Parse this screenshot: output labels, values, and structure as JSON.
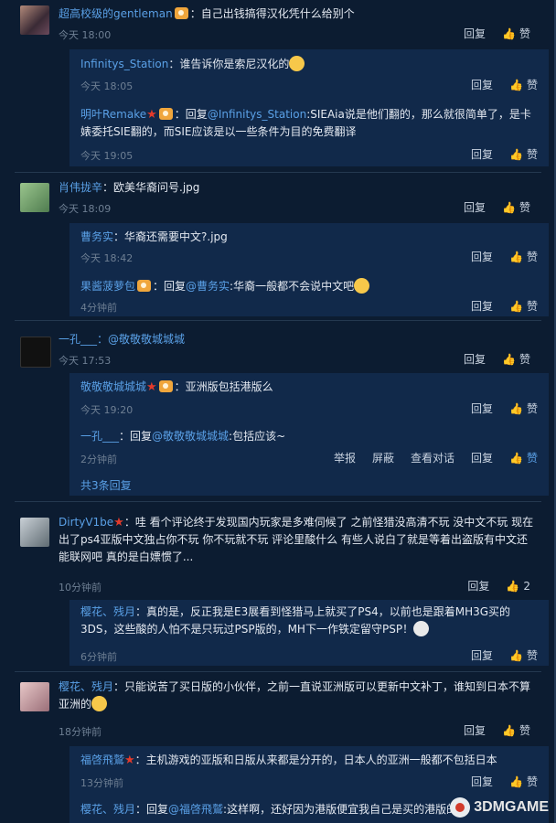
{
  "labels": {
    "reply": "回复",
    "like": "赞",
    "report": "举报",
    "block": "屏蔽",
    "view_conv": "查看对话"
  },
  "c1": {
    "user": "超高校级的gentleman",
    "text": "：自己出钱搞得汉化凭什么给别个",
    "time": "今天 18:00",
    "r1": {
      "user": "Infinitys_Station",
      "text": "：谁告诉你是索尼汉化的",
      "time": "今天 18:05"
    },
    "r2": {
      "user": "明叶Remake",
      "pre": "：回复",
      "mention": "@Infinitys_Station",
      "text": ":SIEAia说是他们翻的，那么就很简单了，是卡婊委托SIE翻的，而SIE应该是以一些条件为目的免费翻译",
      "time": "今天 19:05"
    }
  },
  "c2": {
    "user": "肖伟拢辛",
    "text": "：欧美华裔问号.jpg",
    "time": "今天 18:09",
    "r1": {
      "user": "曹务实",
      "text": "：华裔还需要中文?.jpg",
      "time": "今天 18:42"
    },
    "r2": {
      "user": "果酱菠萝包",
      "pre": "：回复",
      "mention": "@曹务实",
      "text": ":华裔一般都不会说中文吧",
      "time": "4分钟前"
    }
  },
  "c3": {
    "user": "一孔___",
    "text": "：@敬敬敬城城城",
    "time": "今天 17:53",
    "r1": {
      "user": "敬敬敬城城城",
      "text": "：亚洲版包括港版么",
      "time": "今天 19:20"
    },
    "r2": {
      "user": "一孔___",
      "pre": "：回复",
      "mention": "@敬敬敬城城城",
      "text": ":包括应该~",
      "time": "2分钟前"
    },
    "more": "共3条回复"
  },
  "c4": {
    "user": "DirtyV1be",
    "text": "：哇 看个评论终于发现国内玩家是多难伺候了 之前怪猎没高清不玩 没中文不玩 现在出了ps4亚版中文独占你不玩 你不玩就不玩 评论里酸什么 有些人说白了就是等着出盗版有中文还能联网吧 真的是白嫖惯了...",
    "time": "10分钟前",
    "likes": "2",
    "r1": {
      "user": "樱花、残月",
      "text": "：真的是，反正我是E3展看到怪猎马上就买了PS4，以前也是跟着MH3G买的3DS，这些酸的人怕不是只玩过PSP版的，MH下一作铁定留守PSP！",
      "time": "6分钟前"
    }
  },
  "c5": {
    "user": "樱花、残月",
    "text": "：只能说苦了买日版的小伙伴，之前一直说亚洲版可以更新中文补丁，谁知到日本不算亚洲的",
    "time": "18分钟前",
    "r1": {
      "user": "福啓飛鷲",
      "text": "：主机游戏的亚版和日版从来都是分开的，日本人的亚洲一般都不包括日本",
      "time": "13分钟前"
    },
    "r2": {
      "user": "樱花、残月",
      "pre": "：回复",
      "mention": "@福啓飛鷲",
      "text": ":这样啊，还好因为港版便宜我自己是买的港版的"
    }
  },
  "watermark": "3DMGAME"
}
